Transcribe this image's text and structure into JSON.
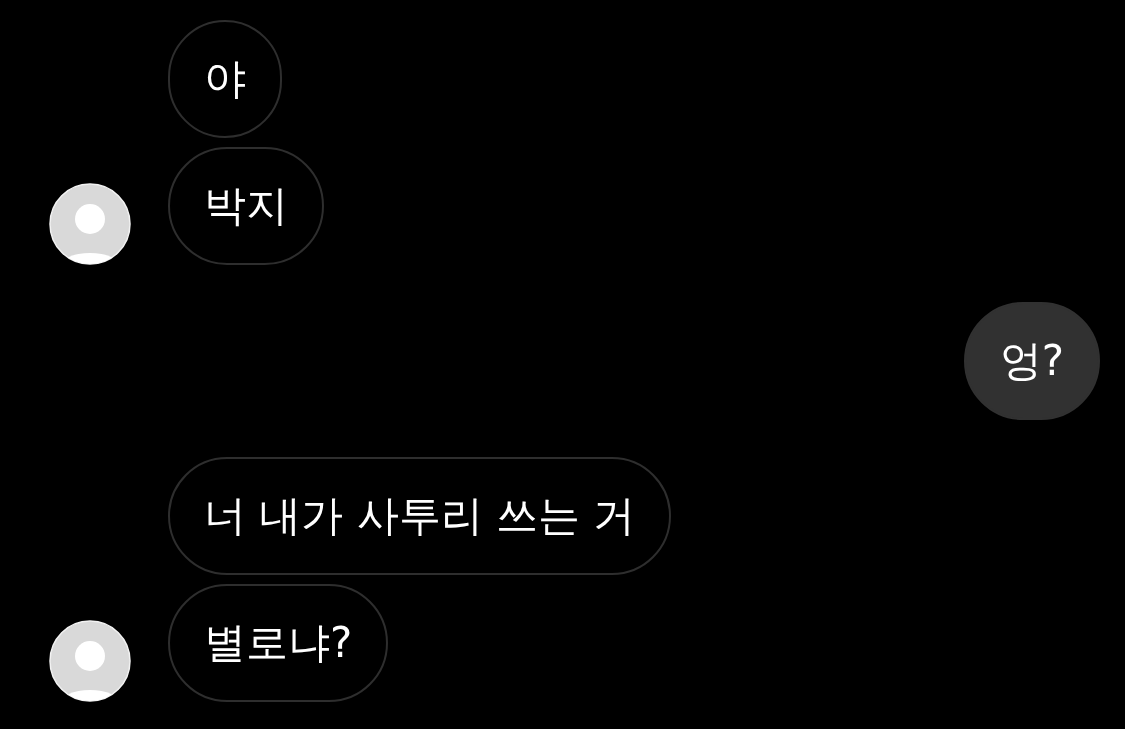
{
  "conversation": [
    {
      "kind": "incoming",
      "messages": [
        "야",
        "박지"
      ]
    },
    {
      "kind": "outgoing",
      "messages": [
        "엉?"
      ]
    },
    {
      "kind": "incoming",
      "messages": [
        "너 내가 사투리 쓰는 거",
        "별로냐?"
      ]
    }
  ]
}
